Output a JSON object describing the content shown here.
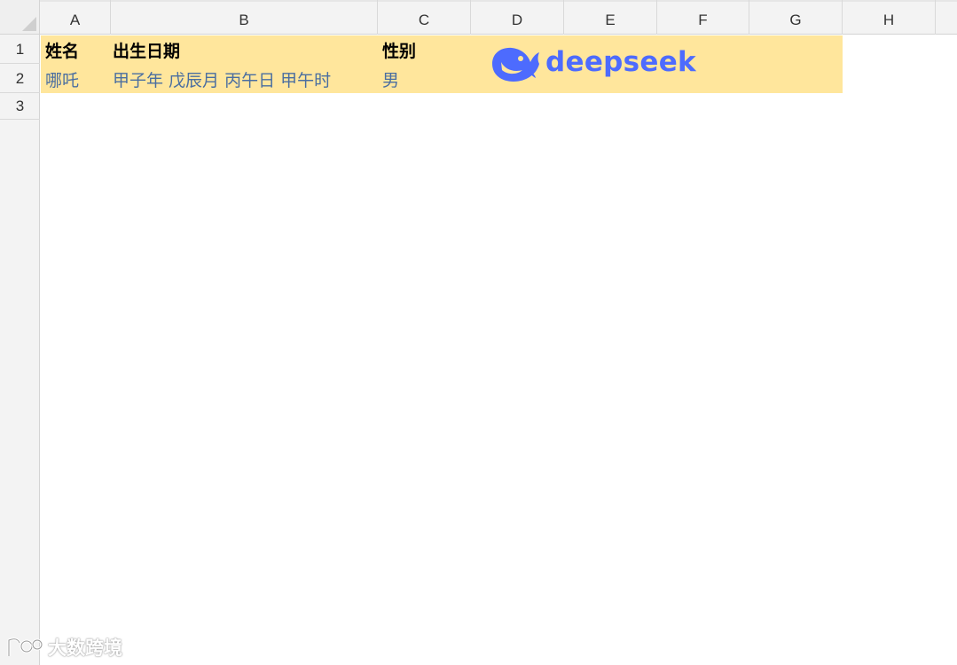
{
  "columns": [
    "A",
    "B",
    "C",
    "D",
    "E",
    "F",
    "G",
    "H"
  ],
  "rows": [
    "1",
    "2",
    "3"
  ],
  "cells": {
    "A1": "姓名",
    "B1": "出生日期",
    "C1": "性别",
    "A2": "哪吒",
    "B2": "甲子年 戊辰月 丙午日 甲午时",
    "C2": "男"
  },
  "logo_text": "deepseek",
  "watermark_text": "大数跨境",
  "colors": {
    "highlight_fill": "#ffe69c",
    "value_text": "#4a6ea0",
    "logo_blue": "#4d6bfe",
    "header_bg": "#f3f3f3"
  },
  "icons": [
    "deepseek-whale-icon",
    "watermark-logo-icon"
  ]
}
